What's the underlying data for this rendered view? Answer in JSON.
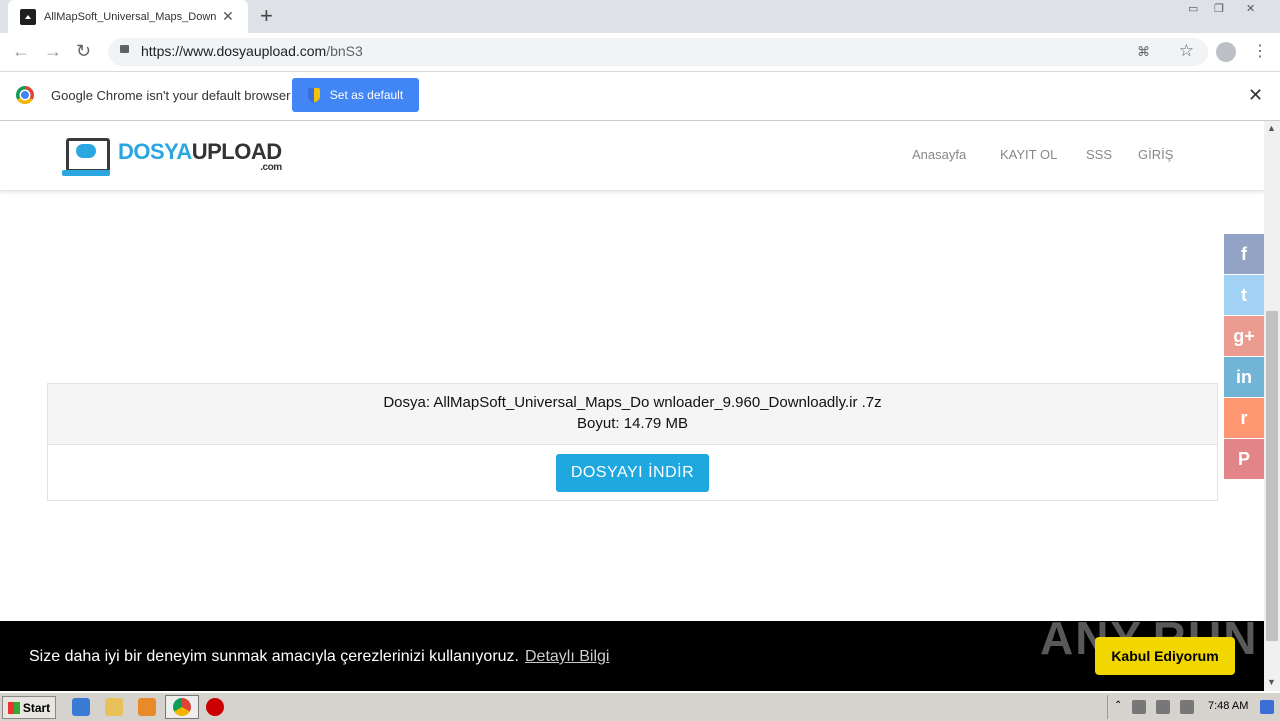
{
  "browser": {
    "tab_title": "AllMapSoft_Universal_Maps_Downlo",
    "tab_close": "✕",
    "new_tab": "+",
    "url_host": "https://www.dosyaupload.com",
    "url_path": "/bnS3"
  },
  "infobar": {
    "message": "Google Chrome isn't your default browser",
    "button_label": "Set as default",
    "close": "✕"
  },
  "site": {
    "logo_part1": "DOSYA",
    "logo_part2": "UPLOAD",
    "logo_suffix": ".com",
    "nav": [
      "Anasayfa",
      "KAYIT OL",
      "SSS",
      "GİRİŞ"
    ]
  },
  "file": {
    "name_line": "Dosya: AllMapSoft_Universal_Maps_Do wnloader_9.960_Downloadly.ir .7z",
    "size_line": "Boyut: 14.79 MB",
    "download_label": "DOSYAYI İNDİR"
  },
  "share": [
    {
      "icon": "facebook-icon",
      "glyph": "f",
      "color": "#3b5998"
    },
    {
      "icon": "twitter-icon",
      "glyph": "t",
      "color": "#55acee"
    },
    {
      "icon": "google-plus-icon",
      "glyph": "g+",
      "color": "#dd4b39"
    },
    {
      "icon": "linkedin-icon",
      "glyph": "in",
      "color": "#0077b5"
    },
    {
      "icon": "reddit-icon",
      "glyph": "r",
      "color": "#ff4500"
    },
    {
      "icon": "pinterest-icon",
      "glyph": "P",
      "color": "#cb2027"
    }
  ],
  "cookie": {
    "message": "Size daha iyi bir deneyim sunmak amacıyla çerezlerinizi kullanıyoruz.",
    "link": "Detaylı Bilgi",
    "accept": "Kabul Ediyorum"
  },
  "watermark": "ANY.RUN",
  "taskbar": {
    "start": "Start",
    "clock": "7:48 AM"
  }
}
